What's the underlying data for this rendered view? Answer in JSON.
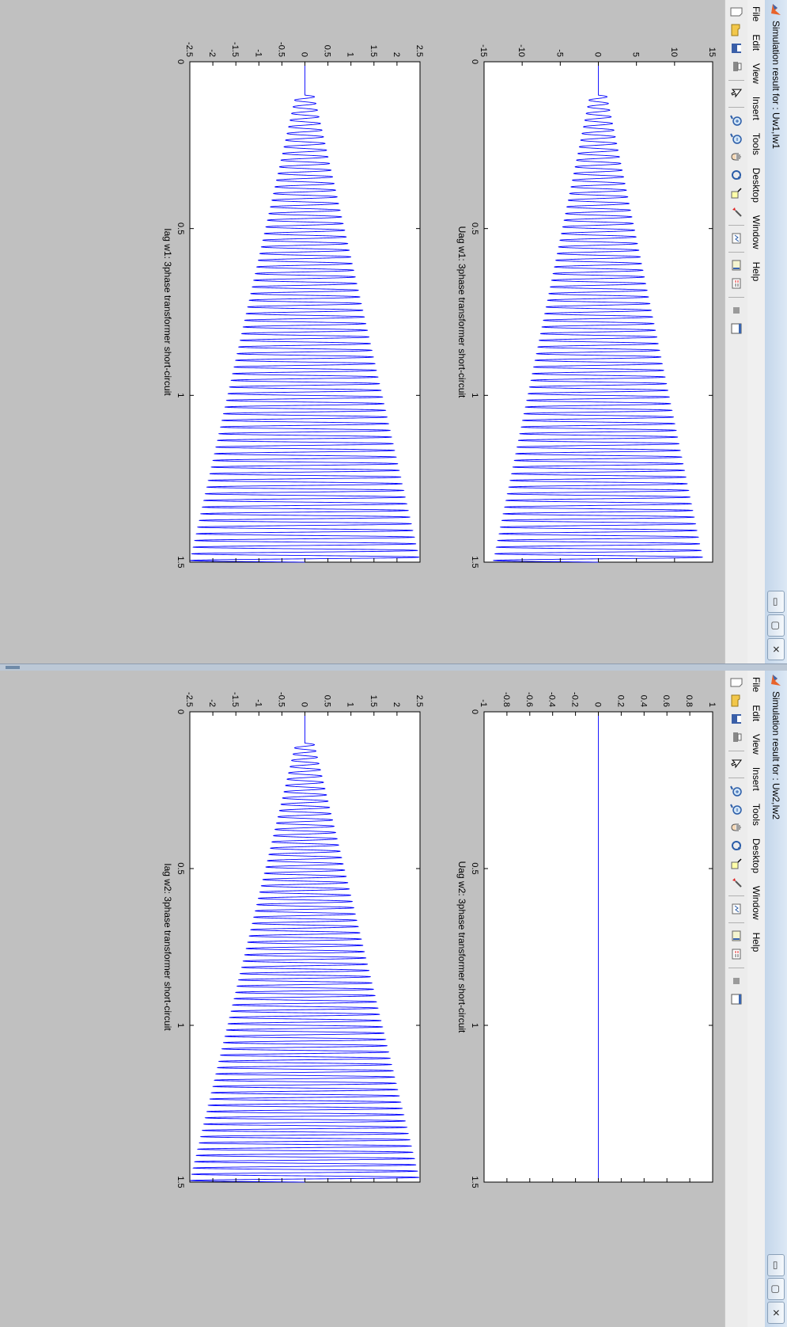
{
  "windows": [
    {
      "title": "Simulation result for : Uw1,Iw1",
      "menu": [
        "File",
        "Edit",
        "View",
        "Insert",
        "Tools",
        "Desktop",
        "Window",
        "Help"
      ],
      "controls": {
        "minimize": "▭",
        "maximize": "▢",
        "close": "✕"
      },
      "dock_arrow": "↘"
    },
    {
      "title": "Simulation result for : Uw2,Iw2",
      "menu": [
        "File",
        "Edit",
        "View",
        "Insert",
        "Tools",
        "Desktop",
        "Window",
        "Help"
      ],
      "controls": {
        "minimize": "▭",
        "maximize": "▢",
        "close": "✕"
      },
      "dock_arrow": "↘"
    }
  ],
  "toolbar_icons": [
    "new-figure-icon",
    "open-file-icon",
    "save-icon",
    "print-icon",
    "edit-plot-icon",
    "zoom-in-icon",
    "zoom-out-icon",
    "pan-icon",
    "rotate-3d-icon",
    "data-cursor-icon",
    "brush-icon",
    "link-plot-icon",
    "colorbar-icon",
    "legend-icon",
    "hide-plot-tools-icon",
    "show-plot-tools-icon"
  ],
  "chart_data": [
    {
      "type": "line",
      "window": 0,
      "title": "Uag w1: 3phase transformer short-circuit",
      "xlim": [
        0,
        1.5
      ],
      "ylim": [
        -15,
        15
      ],
      "xticks": [
        "0",
        "0.5",
        "1",
        "1.5"
      ],
      "yticks": [
        "-15",
        "-10",
        "-5",
        "0",
        "5",
        "10",
        "15"
      ],
      "signal": {
        "onset": 0.1,
        "amplitude_at_onset": 1.1,
        "amplitude_at_end": 13.8,
        "frequency_hz": 50
      },
      "color": "#0000ff"
    },
    {
      "type": "line",
      "window": 0,
      "title": "Iag w1: 3phase transformer short-circuit",
      "xlim": [
        0,
        1.5
      ],
      "ylim": [
        -2.5,
        2.5
      ],
      "xticks": [
        "0",
        "0.5",
        "1",
        "1.5"
      ],
      "yticks": [
        "-2.5",
        "-2",
        "-1.5",
        "-1",
        "-0.5",
        "0",
        "0.5",
        "1",
        "1.5",
        "2",
        "2.5"
      ],
      "signal": {
        "onset": 0.1,
        "amplitude_at_onset": 0.2,
        "amplitude_at_end": 2.5,
        "frequency_hz": 50
      },
      "color": "#0000ff"
    },
    {
      "type": "line",
      "window": 1,
      "title": "Uag w2: 3phase transformer short-circuit",
      "xlim": [
        0,
        1.5
      ],
      "ylim": [
        -1,
        1
      ],
      "xticks": [
        "0",
        "0.5",
        "1",
        "1.5"
      ],
      "yticks": [
        "-1",
        "-0.8",
        "-0.6",
        "-0.4",
        "-0.2",
        "0",
        "0.2",
        "0.4",
        "0.6",
        "0.8",
        "1"
      ],
      "signal": {
        "onset": 0.1,
        "amplitude_at_onset": 0,
        "amplitude_at_end": 0,
        "frequency_hz": 50
      },
      "color": "#0000ff"
    },
    {
      "type": "line",
      "window": 1,
      "title": "Iag w2: 3phase transformer short-circuit",
      "xlim": [
        0,
        1.5
      ],
      "ylim": [
        -2.5,
        2.5
      ],
      "xticks": [
        "0",
        "0.5",
        "1",
        "1.5"
      ],
      "yticks": [
        "-2.5",
        "-2",
        "-1.5",
        "-1",
        "-0.5",
        "0",
        "0.5",
        "1",
        "1.5",
        "2",
        "2.5"
      ],
      "signal": {
        "onset": 0.1,
        "amplitude_at_onset": 0.2,
        "amplitude_at_end": 2.5,
        "frequency_hz": 50
      },
      "color": "#0000ff"
    }
  ]
}
